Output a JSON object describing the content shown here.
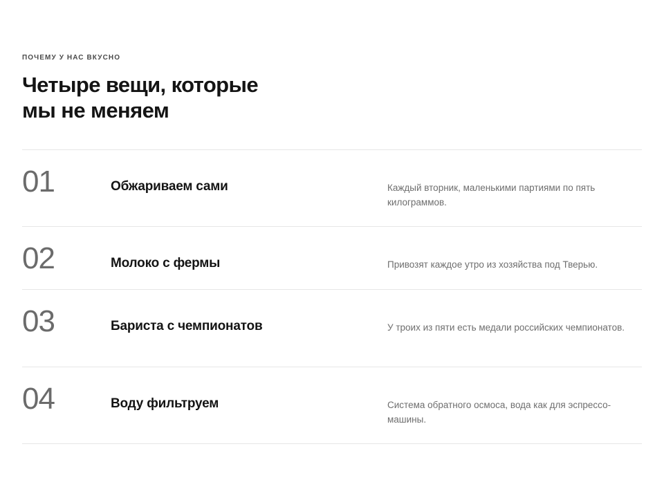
{
  "section": {
    "eyebrow": "ПОЧЕМУ У НАС ВКУСНО",
    "title_line1": "Четыре вещи, которые",
    "title_line2": "мы не меняем"
  },
  "items": [
    {
      "number": "01",
      "title": "Обжариваем сами",
      "description": "Каждый вторник, маленькими партиями по пять килограммов."
    },
    {
      "number": "02",
      "title": "Молоко с фермы",
      "description": "Привозят каждое утро из хозяйства под Тверью."
    },
    {
      "number": "03",
      "title": "Бариста с чемпионатов",
      "description": "У троих из пяти есть медали российских чемпионатов."
    },
    {
      "number": "04",
      "title": "Воду фильтруем",
      "description": "Система обратного осмоса, вода как для эспрессо-машины."
    }
  ]
}
